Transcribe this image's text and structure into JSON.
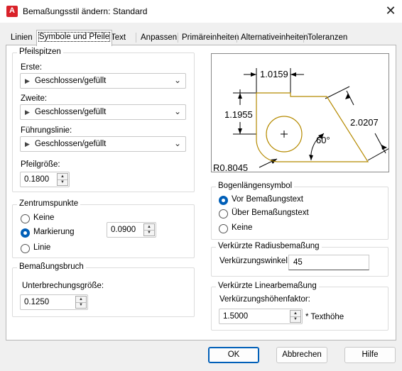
{
  "window": {
    "title": "Bemaßungsstil ändern: Standard",
    "icon": "autocad-icon",
    "close": "✕"
  },
  "tabs": [
    {
      "label": "Linien"
    },
    {
      "label": "Symbole und Pfeile"
    },
    {
      "label": "Text"
    },
    {
      "label": "Anpassen"
    },
    {
      "label": "Primäreinheiten"
    },
    {
      "label": "Alternativeinheiten"
    },
    {
      "label": "Toleranzen"
    }
  ],
  "arrowheads": {
    "legend": "Pfeilspitzen",
    "first_label": "Erste:",
    "first_value": "Geschlossen/gefüllt",
    "second_label": "Zweite:",
    "second_value": "Geschlossen/gefüllt",
    "leader_label": "Führungslinie:",
    "leader_value": "Geschlossen/gefüllt",
    "size_label": "Pfeilgröße:",
    "size_value": "0.1800"
  },
  "center_marks": {
    "legend": "Zentrumspunkte",
    "options": [
      "Keine",
      "Markierung",
      "Linie"
    ],
    "selected": "Markierung",
    "size_value": "0.0900"
  },
  "dimension_break": {
    "legend": "Bemaßungsbruch",
    "label": "Unterbrechungsgröße:",
    "value": "0.1250"
  },
  "preview": {
    "dim_top": "1.0159",
    "dim_left": "1.1955",
    "dim_right": "2.0207",
    "angle": "60°",
    "radius": "R0.8045",
    "color": "#b58a00"
  },
  "arc_length": {
    "legend": "Bogenlängensymbol",
    "options": [
      "Vor Bemaßungstext",
      "Über Bemaßungstext",
      "Keine"
    ],
    "selected": "Vor Bemaßungstext"
  },
  "radius_jog": {
    "legend": "Verkürzte Radiusbemaßung",
    "label": "Verkürzungswinkel:",
    "value": "45"
  },
  "linear_jog": {
    "legend": "Verkürzte Linearbemaßung",
    "label": "Verkürzungshöhenfaktor:",
    "value": "1.5000",
    "suffix": "* Texthöhe"
  },
  "buttons": {
    "ok": "OK",
    "cancel": "Abbrechen",
    "help": "Hilfe"
  }
}
